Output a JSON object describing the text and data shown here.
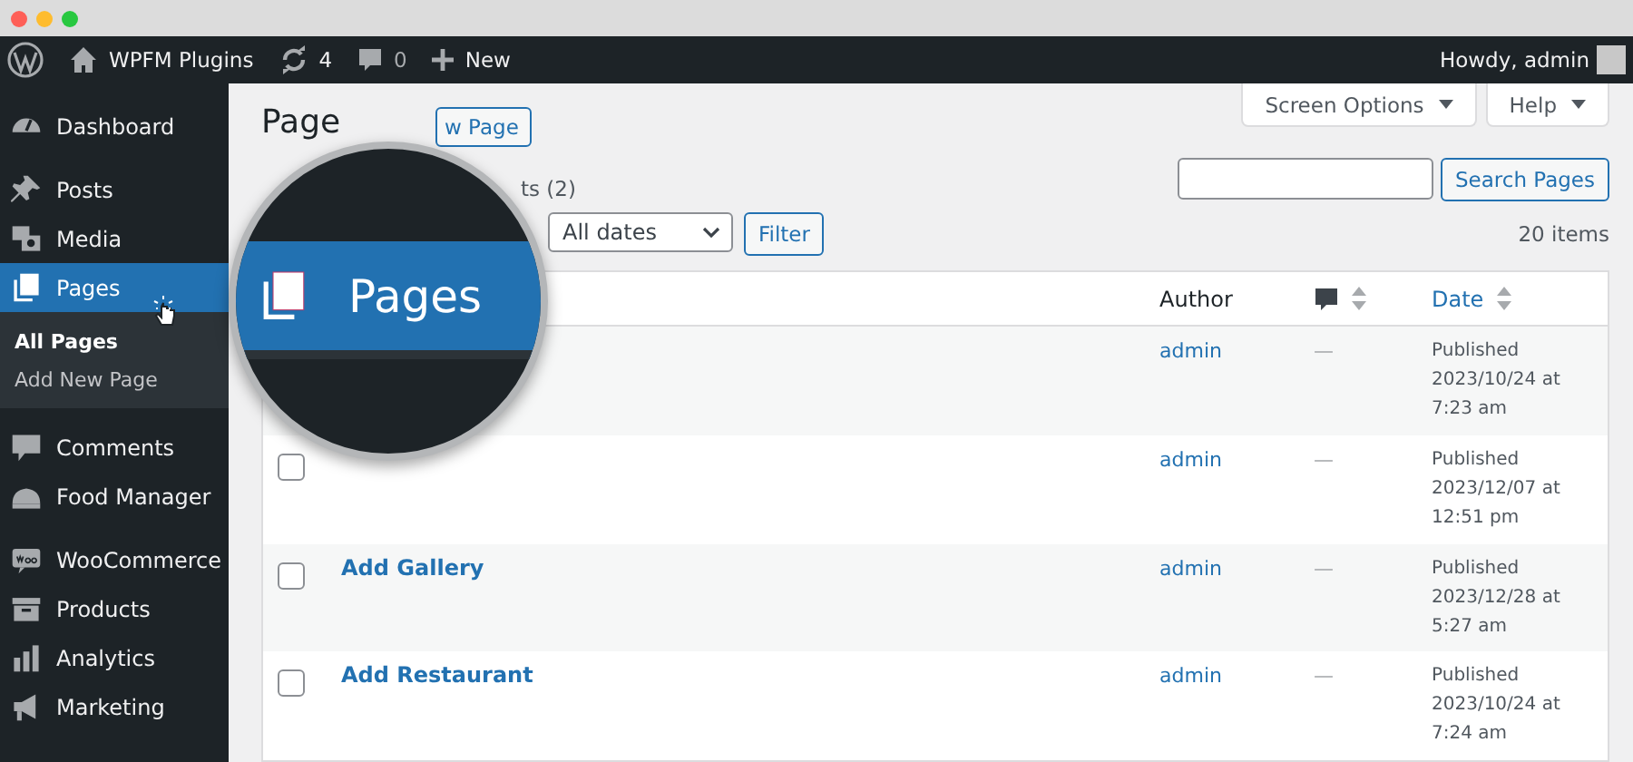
{
  "admin_bar": {
    "site": "WPFM Plugins",
    "updates": "4",
    "comments": "0",
    "new": "New",
    "greeting": "Howdy, admin"
  },
  "sidebar": {
    "items": [
      {
        "label": "Dashboard",
        "selected": false
      },
      {
        "label": "Posts",
        "selected": false
      },
      {
        "label": "Media",
        "selected": false
      },
      {
        "label": "Pages",
        "selected": true,
        "children": [
          {
            "label": "All Pages",
            "selected": true
          },
          {
            "label": "Add New Page",
            "selected": false
          }
        ]
      },
      {
        "label": "Comments",
        "selected": false
      },
      {
        "label": "Food Manager",
        "selected": false
      },
      {
        "label": "WooCommerce",
        "selected": false
      },
      {
        "label": "Products",
        "selected": false
      },
      {
        "label": "Analytics",
        "selected": false
      },
      {
        "label": "Marketing",
        "selected": false
      }
    ]
  },
  "screen_meta": [
    "Screen Options",
    "Help"
  ],
  "heading": "Page",
  "add_new_button": "w Page",
  "views": "ts (2)",
  "search": {
    "button": "Search Pages"
  },
  "filters": {
    "date": "All dates",
    "button": "Filter"
  },
  "item_count": "20 items",
  "table": {
    "columns": [
      {
        "kind": "text",
        "label": "Author"
      },
      {
        "kind": "comments"
      },
      {
        "kind": "sortable",
        "label": "Date"
      }
    ],
    "rows": [
      {
        "author": "admin",
        "comments": "—",
        "status": "Published",
        "date": "2023/10/24 at 7:23 am"
      },
      {
        "checked": false,
        "author": "admin",
        "comments": "—",
        "status": "Published",
        "date": "2023/12/07 at 12:51 pm"
      },
      {
        "checked": false,
        "title": "Add Gallery",
        "author": "admin",
        "comments": "—",
        "status": "Published",
        "date": "2023/12/28 at 5:27 am"
      },
      {
        "checked": false,
        "title": "Add Restaurant",
        "author": "admin",
        "comments": "—",
        "status": "Published",
        "date": "2023/10/24 at 7:24 am"
      }
    ]
  },
  "magnifier": {
    "label": "Pages"
  }
}
